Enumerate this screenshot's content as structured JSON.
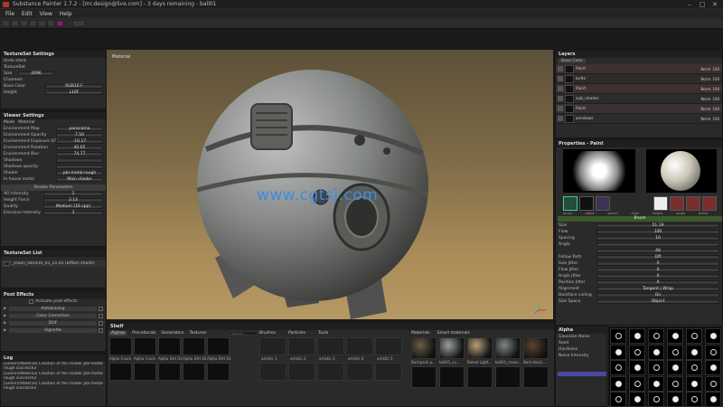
{
  "window": {
    "title": "Substance Painter 1.7.2 - [mr.design@live.com] - 3 days remaining - ball01"
  },
  "menu": [
    "File",
    "Edit",
    "View",
    "Help"
  ],
  "textureset_settings": {
    "title": "TextureSet Settings",
    "undo_stack": "Undo stack",
    "textureset_label": "TextureSet",
    "size_label": "Size",
    "size_value": "4096",
    "channels_label": "Channels",
    "base_color_label": "Base Color",
    "base_color_format": "RGB16 F",
    "height_label": "Height",
    "height_format": "L16F"
  },
  "viewer_settings": {
    "title": "Viewer Settings",
    "tabs": [
      "Mode",
      "Material"
    ],
    "rows": [
      {
        "label": "Environment Map",
        "value": "panorama"
      },
      {
        "label": "Environment Opacity",
        "value": "7.50"
      },
      {
        "label": "Environment Exposure (EV)",
        "value": "-10.17"
      },
      {
        "label": "Environment Rotation",
        "value": "40.65"
      },
      {
        "label": "Environment Blur",
        "value": "74.77"
      },
      {
        "label": "Shadows",
        "value": ""
      },
      {
        "label": "Shadows opacity",
        "value": ""
      },
      {
        "label": "Shader",
        "value": "pbr-metal-rough"
      },
      {
        "label": "In-house metal",
        "value": "Main shader"
      }
    ],
    "shader_params_title": "Shader Parameters",
    "shader_rows": [
      {
        "label": "AO Intensity",
        "value": "1"
      },
      {
        "label": "Height Force",
        "value": "3.14"
      },
      {
        "label": "Quality",
        "value": "Medium (16 spp)"
      },
      {
        "label": "Emissive Intensity",
        "value": "1"
      }
    ]
  },
  "textureset_list": {
    "title": "TextureSet List",
    "item_name": "_moon_081910_01_21:45 (ball-02)",
    "item_shader": "Main shader"
  },
  "post_effects": {
    "title": "Post Effects",
    "activate_label": "Activate post effects",
    "items": [
      "Antialiasing",
      "Color Correction",
      "DOF",
      "Vignette"
    ]
  },
  "log": {
    "title": "Log",
    "lines": [
      "[GenericMaterial] Creation of the shader pbr-metal-",
      "rough successful",
      "[GenericMaterial] Creation of the shader pbr-metal-",
      "rough successful",
      "[GenericMaterial] Creation of the shader pbr-metal-",
      "rough successful"
    ]
  },
  "viewport": {
    "label": "Material"
  },
  "watermark": "www.cgtsj.com",
  "layers": {
    "title": "Layers",
    "blend_mode": "Base Color",
    "items": [
      {
        "name": "Paint",
        "mode": "Norm",
        "opacity": "100"
      },
      {
        "name": "bolts",
        "mode": "Norm",
        "opacity": "100"
      },
      {
        "name": "Paint",
        "mode": "Norm",
        "opacity": "100"
      },
      {
        "name": "sub_shader",
        "mode": "Norm",
        "opacity": "100"
      },
      {
        "name": "Paint",
        "mode": "Norm",
        "opacity": "100"
      },
      {
        "name": "windows",
        "mode": "Norm",
        "opacity": "100"
      }
    ]
  },
  "properties": {
    "title": "Properties - Paint",
    "mini_labels": [
      "brush",
      "alpha",
      "stencil",
      "color",
      "height",
      "rough",
      "metal"
    ],
    "brush_section": "Brush",
    "rows": [
      {
        "label": "Size",
        "value": "51.19"
      },
      {
        "label": "Flow",
        "value": "100"
      },
      {
        "label": "Spacing",
        "value": "10"
      },
      {
        "label": "Angle",
        "value": ""
      },
      {
        "label": "",
        "value": "48"
      },
      {
        "label": "Follow Path",
        "value": "Off"
      },
      {
        "label": "Size Jitter",
        "value": "0"
      },
      {
        "label": "Flow Jitter",
        "value": "0"
      },
      {
        "label": "Angle Jitter",
        "value": "0"
      },
      {
        "label": "Position Jitter",
        "value": "0"
      },
      {
        "label": "Alignment",
        "value": "Tangent | Wrap"
      },
      {
        "label": "Backface culling",
        "value": "On"
      },
      {
        "label": "Size Space",
        "value": "Object"
      }
    ]
  },
  "shelf": {
    "title": "Shelf",
    "tabs": [
      "Alphas",
      "Procedurals",
      "Generators",
      "Textures"
    ],
    "search_placeholder": "Search...",
    "alpha_items": [
      "Alpha Crack",
      "Alpha Crack",
      "Alpha Dirt 01",
      "Alpha Dirt 02",
      "Alpha Dirt 03"
    ],
    "brush_tabs": [
      "Brushes",
      "Particles",
      "Tools"
    ],
    "brush_items": [
      "artistic 1",
      "artistic 2",
      "artistic 3",
      "artistic 4",
      "artistic 5"
    ],
    "material_tabs": [
      "Materials",
      "Smart materials"
    ],
    "material_items": [
      "Backpack p...",
      "ball01_su...",
      "Baked Light...",
      "ball01_moon...",
      "Bark black..."
    ]
  },
  "alpha_panel": {
    "title": "Alpha",
    "rows": [
      {
        "label": "Gaussian Noise",
        "value": ""
      },
      {
        "label": "Seed",
        "value": ""
      },
      {
        "label": "Hardness",
        "value": ""
      },
      {
        "label": "Noise Intensity",
        "value": ""
      }
    ]
  }
}
